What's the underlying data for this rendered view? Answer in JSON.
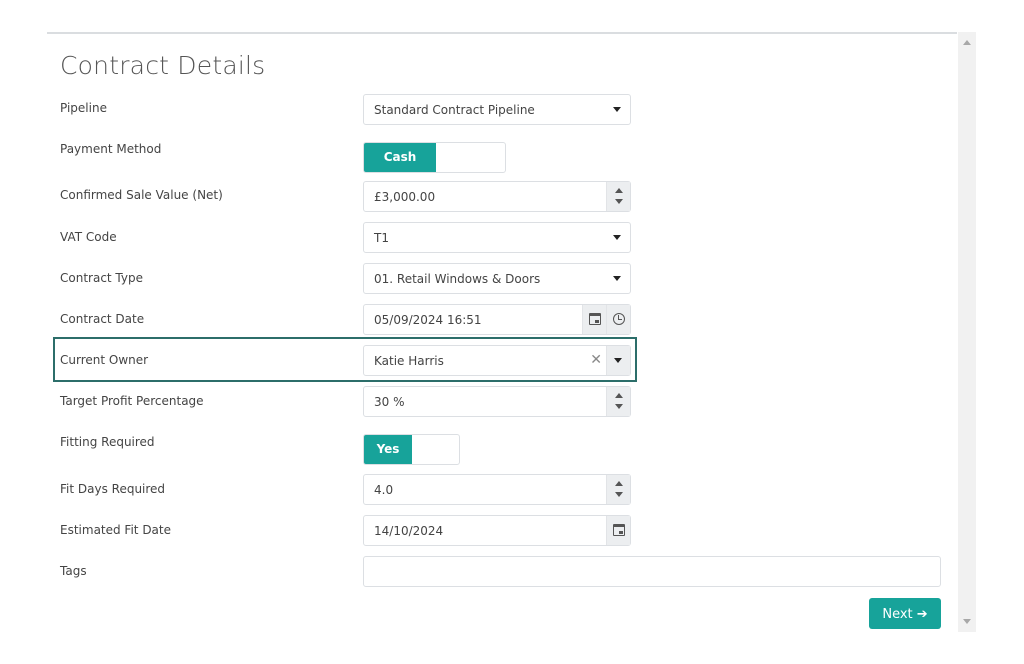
{
  "form": {
    "title": "Contract Details",
    "pipeline": {
      "label": "Pipeline",
      "value": "Standard Contract Pipeline"
    },
    "payment_method": {
      "label": "Payment Method",
      "value": "Cash"
    },
    "confirmed_sale_value": {
      "label": "Confirmed Sale Value (Net)",
      "value": "£3,000.00"
    },
    "vat_code": {
      "label": "VAT Code",
      "value": "T1"
    },
    "contract_type": {
      "label": "Contract Type",
      "value": "01. Retail Windows & Doors"
    },
    "contract_date": {
      "label": "Contract Date",
      "value": "05/09/2024 16:51"
    },
    "current_owner": {
      "label": "Current Owner",
      "value": "Katie Harris"
    },
    "target_profit": {
      "label": "Target Profit Percentage",
      "value": "30 %"
    },
    "fitting_required": {
      "label": "Fitting Required",
      "value": "Yes"
    },
    "fit_days": {
      "label": "Fit Days Required",
      "value": "4.0"
    },
    "estimated_fit_date": {
      "label": "Estimated Fit Date",
      "value": "14/10/2024"
    },
    "tags": {
      "label": "Tags",
      "value": ""
    },
    "next_label": "Next ➔"
  },
  "colors": {
    "accent": "#17a39a",
    "highlight_border": "#2c6e6a"
  }
}
